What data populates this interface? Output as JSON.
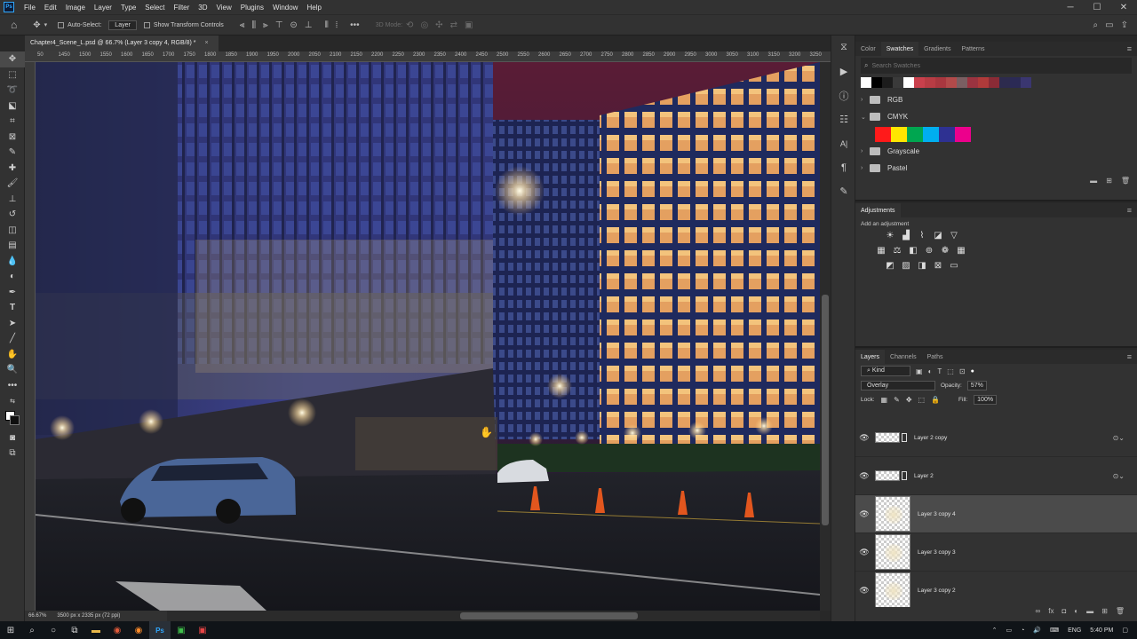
{
  "app": {
    "logo_text": "Ps"
  },
  "menubar": {
    "items": [
      "File",
      "Edit",
      "Image",
      "Layer",
      "Type",
      "Select",
      "Filter",
      "3D",
      "View",
      "Plugins",
      "Window",
      "Help"
    ]
  },
  "options": {
    "auto_select_label": "Auto-Select:",
    "auto_select_target": "Layer",
    "show_transform_label": "Show Transform Controls",
    "mode_3d_label": "3D Mode:"
  },
  "document": {
    "tab_title": "Chapter4_Scene_L.psd @ 66.7% (Layer 3 copy 4, RGB/8) *"
  },
  "ruler": {
    "ticks": [
      "50",
      "1450",
      "1500",
      "1550",
      "1600",
      "1650",
      "1700",
      "1750",
      "1800",
      "1850",
      "1900",
      "1950",
      "2000",
      "2050",
      "2100",
      "2150",
      "2200",
      "2250",
      "2300",
      "2350",
      "2400",
      "2450",
      "2500",
      "2550",
      "2600",
      "2650",
      "2700",
      "2750",
      "2800",
      "2850",
      "2900",
      "2950",
      "3000",
      "3050",
      "3100",
      "3150",
      "3200",
      "3250",
      "3300"
    ]
  },
  "status": {
    "zoom": "66.67%",
    "doc_size": "3500 px x 2335 px (72 ppi)"
  },
  "swatches_panel": {
    "tabs": [
      "Color",
      "Swatches",
      "Gradients",
      "Patterns"
    ],
    "active_tab": "Swatches",
    "search_placeholder": "Search Swatches",
    "recent_colors": [
      "#ffffff",
      "#000000",
      "#1c1c1c",
      "#3a3a3a",
      "#ffffff",
      "#c9404c",
      "#b83c44",
      "#a9373f",
      "#b24a4a",
      "#7a5f62",
      "#9b3340",
      "#b03a3a",
      "#8a2b36",
      "#2d2b4e",
      "#2b2a55",
      "#3a3670"
    ],
    "groups": [
      {
        "name": "RGB",
        "expanded": false
      },
      {
        "name": "CMYK",
        "expanded": true,
        "colors": [
          "#ff1a1a",
          "#ffe600",
          "#00a650",
          "#00aeef",
          "#2e3192",
          "#ec008c"
        ]
      },
      {
        "name": "Grayscale",
        "expanded": false
      },
      {
        "name": "Pastel",
        "expanded": false
      }
    ]
  },
  "adjustments_panel": {
    "title": "Adjustments",
    "subtitle": "Add an adjustment",
    "rows": [
      [
        "brightness-icon",
        "levels-icon",
        "curves-icon",
        "exposure-icon",
        "vibrance-icon"
      ],
      [
        "hue-sat-icon",
        "color-balance-icon",
        "bw-icon",
        "photo-filter-icon",
        "channel-mixer-icon",
        "color-lookup-icon"
      ],
      [
        "invert-icon",
        "posterize-icon",
        "threshold-icon",
        "selective-color-icon",
        "gradient-map-icon"
      ]
    ]
  },
  "layers_panel": {
    "tabs": [
      "Layers",
      "Channels",
      "Paths"
    ],
    "active_tab": "Layers",
    "filter_kind": "Kind",
    "blend_mode": "Overlay",
    "opacity_label": "Opacity:",
    "opacity_value": "57%",
    "lock_label": "Lock:",
    "fill_label": "Fill:",
    "fill_value": "100%",
    "layers": [
      {
        "name": "Layer 2 copy",
        "selected": false,
        "smart": true
      },
      {
        "name": "Layer 2",
        "selected": false,
        "smart": true
      },
      {
        "name": "Layer 3 copy 4",
        "selected": true,
        "smart": false
      },
      {
        "name": "Layer 3 copy 3",
        "selected": false,
        "smart": false
      },
      {
        "name": "Layer 3 copy 2",
        "selected": false,
        "smart": false
      }
    ]
  },
  "taskbar": {
    "language": "ENG",
    "time": "5:40 PM"
  }
}
